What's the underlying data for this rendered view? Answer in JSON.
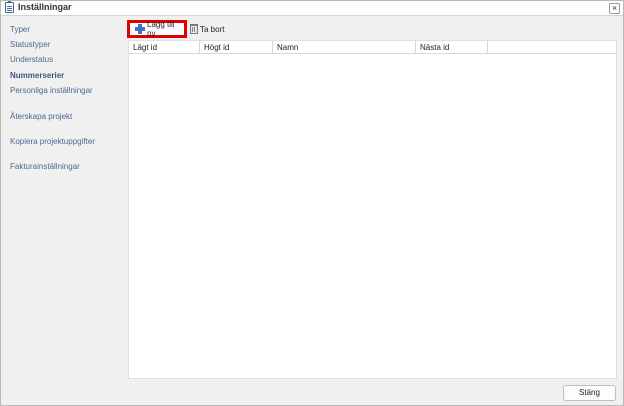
{
  "window": {
    "title": "Inställningar",
    "close_symbol": "×"
  },
  "sidebar": {
    "items": [
      {
        "label": "Typer"
      },
      {
        "label": "Statustyper"
      },
      {
        "label": "Understatus"
      },
      {
        "label": "Nummerserier",
        "active": true
      },
      {
        "label": "Personliga inställningar"
      },
      {
        "label": "Återskapa projekt"
      },
      {
        "label": "Kopiera projektuppgifter"
      },
      {
        "label": "Fakturainställningar"
      }
    ]
  },
  "toolbar": {
    "add_label": "Lägg till ny",
    "delete_label": "Ta bort"
  },
  "grid": {
    "columns": [
      "Lägt id",
      "Högt id",
      "Namn",
      "Nästa id",
      ""
    ]
  },
  "footer": {
    "close_label": "Stäng"
  },
  "colors": {
    "highlight_border": "#e00000",
    "nav_text": "#4a6896",
    "plus_icon": "#3a72c4"
  }
}
